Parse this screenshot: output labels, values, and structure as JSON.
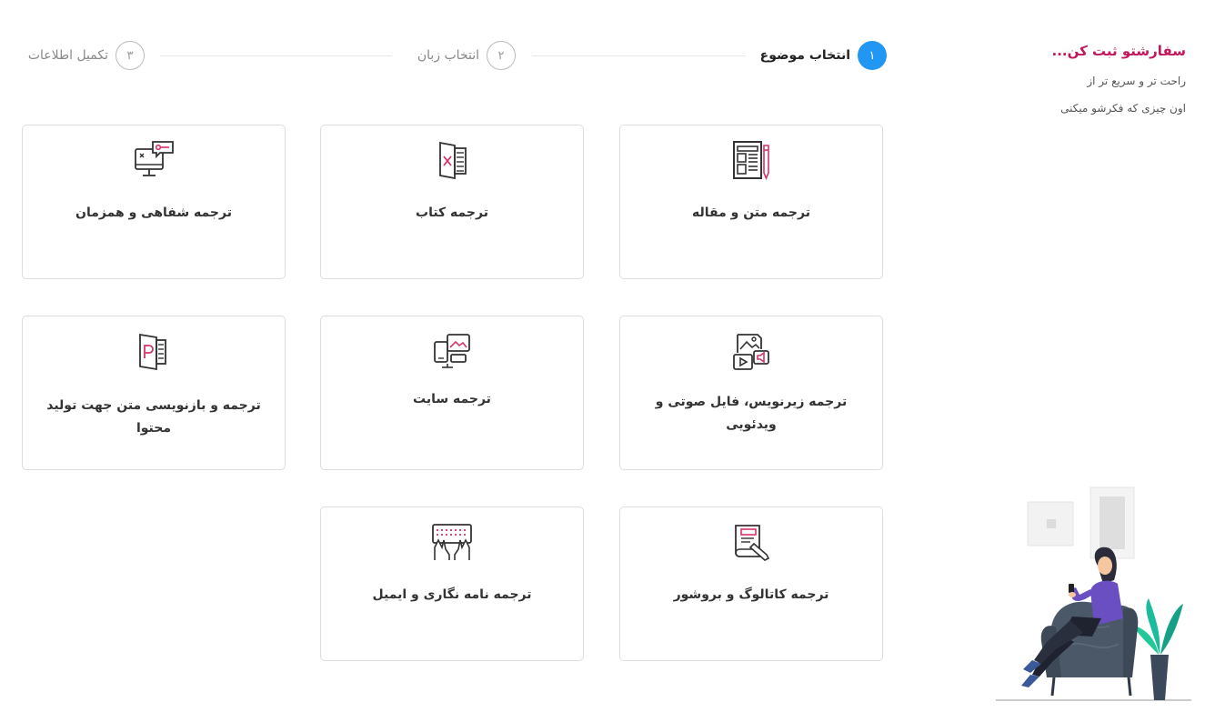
{
  "sidebar": {
    "title": "سفارشتو ثبت کن...",
    "line1": "راحت تر و سریع تر از",
    "line2": "اون چیزی که فکرشو میکنی"
  },
  "steps": [
    {
      "number": "۱",
      "label": "انتخاب موضوع",
      "state": "active"
    },
    {
      "number": "۲",
      "label": "انتخاب زبان",
      "state": "inactive"
    },
    {
      "number": "۳",
      "label": "تکمیل اطلاعات",
      "state": "inactive"
    }
  ],
  "cards": [
    {
      "label": "ترجمه متن و مقاله",
      "icon": "newspaper-pencil-icon"
    },
    {
      "label": "ترجمه کتاب",
      "icon": "book-excel-icon"
    },
    {
      "label": "ترجمه شفاهی و همزمان",
      "icon": "monitor-chat-icon"
    },
    {
      "label": "ترجمه زیرنویس، فایل صوتی و ویدئویی",
      "icon": "media-files-icon"
    },
    {
      "label": "ترجمه سایت",
      "icon": "devices-icon"
    },
    {
      "label": "ترجمه و بازنویسی متن جهت تولید محتوا",
      "icon": "powerpoint-doc-icon"
    },
    {
      "label": "ترجمه کاتالوگ و بروشور",
      "icon": "catalog-pencil-icon"
    },
    {
      "label": "ترجمه نامه نگاری و ایمیل",
      "icon": "keyboard-hands-icon"
    }
  ],
  "colors": {
    "accent": "#2196f3",
    "brand": "#c2185b",
    "icon_pink": "#d6336c",
    "icon_stroke": "#333333"
  }
}
